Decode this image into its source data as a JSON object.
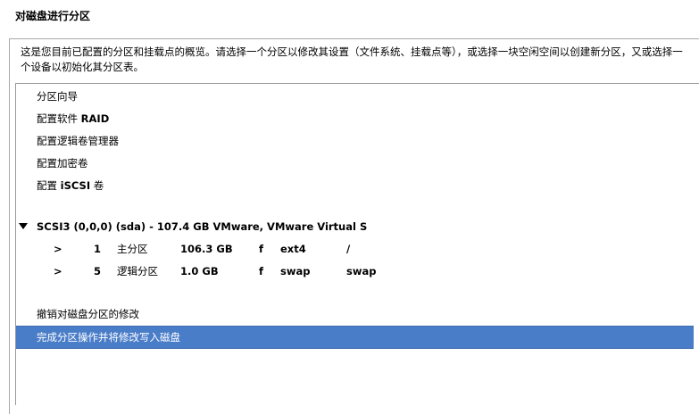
{
  "page": {
    "title": "对磁盘进行分区",
    "description": "这是您目前已配置的分区和挂载点的概览。请选择一个分区以修改其设置（文件系统、挂载点等），或选择一块空闲空间以创建新分区，又或选择一个设备以初始化其分区表。"
  },
  "menu": {
    "items": [
      {
        "parts": [
          "分区向导"
        ]
      },
      {
        "parts": [
          "配置软件 ",
          "RAID"
        ]
      },
      {
        "parts": [
          "配置逻辑卷管理器"
        ]
      },
      {
        "parts": [
          "配置加密卷"
        ]
      },
      {
        "parts": [
          "配置 ",
          "iSCSI",
          " 卷"
        ]
      }
    ]
  },
  "disk": {
    "label": "SCSI3 (0,0,0) (sda) - 107.4 GB VMware, VMware Virtual S",
    "expanded": true,
    "partitions": [
      {
        "arrow": ">",
        "number": "1",
        "type": "主分区",
        "size": "106.3 GB",
        "flag": "f",
        "fs": "ext4",
        "mount": "/"
      },
      {
        "arrow": ">",
        "number": "5",
        "type": "逻辑分区",
        "size": "1.0 GB",
        "flag": "f",
        "fs": "swap",
        "mount": "swap"
      }
    ]
  },
  "actions": {
    "undo": "撤销对磁盘分区的修改",
    "finish": "完成分区操作并将修改写入磁盘"
  },
  "colors": {
    "selection": "#4a7dc8",
    "border": "#a9a9a9"
  }
}
